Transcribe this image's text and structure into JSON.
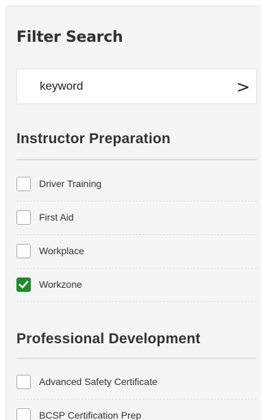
{
  "filter_panel": {
    "title": "Filter Search",
    "search": {
      "value": "keyword",
      "placeholder": "keyword",
      "submit_label": ">"
    },
    "sections": [
      {
        "title": "Instructor Preparation",
        "options": [
          {
            "label": "Driver Training",
            "checked": false
          },
          {
            "label": "First Aid",
            "checked": false
          },
          {
            "label": "Workplace",
            "checked": false
          },
          {
            "label": "Workzone",
            "checked": true
          }
        ]
      },
      {
        "title": "Professional Development",
        "options": [
          {
            "label": "Advanced Safety Certificate",
            "checked": false
          },
          {
            "label": "BCSP Certification Prep",
            "checked": false
          }
        ]
      }
    ]
  },
  "colors": {
    "panel_background": "#f5f5f5",
    "checked_accent": "#1f8a2c",
    "text": "#333333"
  }
}
